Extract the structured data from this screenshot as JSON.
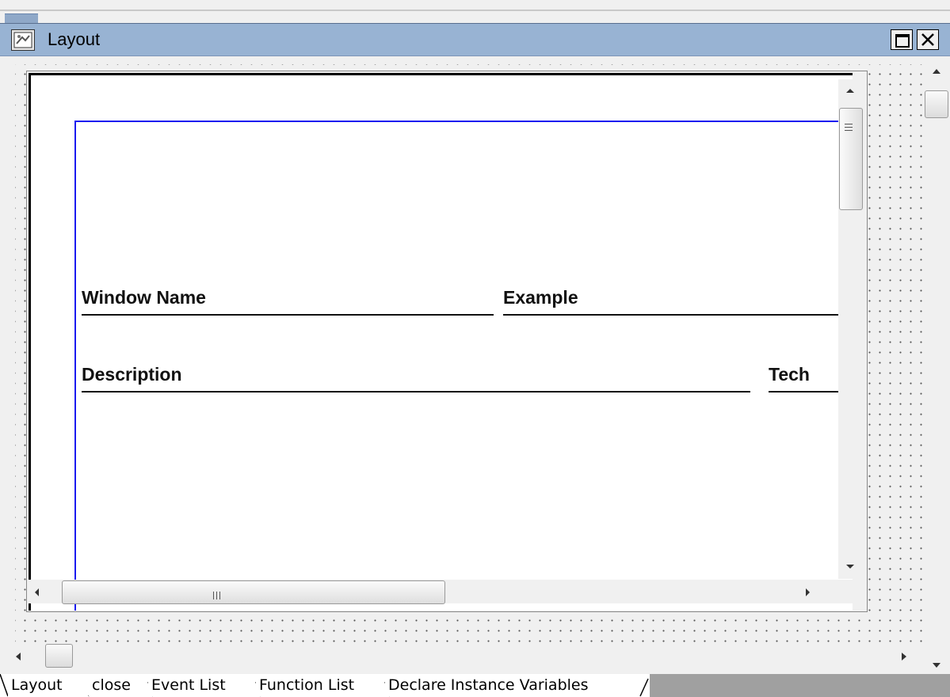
{
  "window": {
    "title": "Layout"
  },
  "report": {
    "labels": {
      "window_name": "Window Name",
      "example": "Example",
      "description": "Description",
      "tech": "Tech"
    }
  },
  "tabs": [
    {
      "label": "Layout",
      "active": true
    },
    {
      "label": "close",
      "active": false
    },
    {
      "label": "Event List",
      "active": false
    },
    {
      "label": "Function List",
      "active": false
    },
    {
      "label": "Declare Instance Variables",
      "active": false
    }
  ],
  "colors": {
    "titlebar": "#98b3d3",
    "report_border": "#1a1af0",
    "background": "#f0f0f0"
  }
}
